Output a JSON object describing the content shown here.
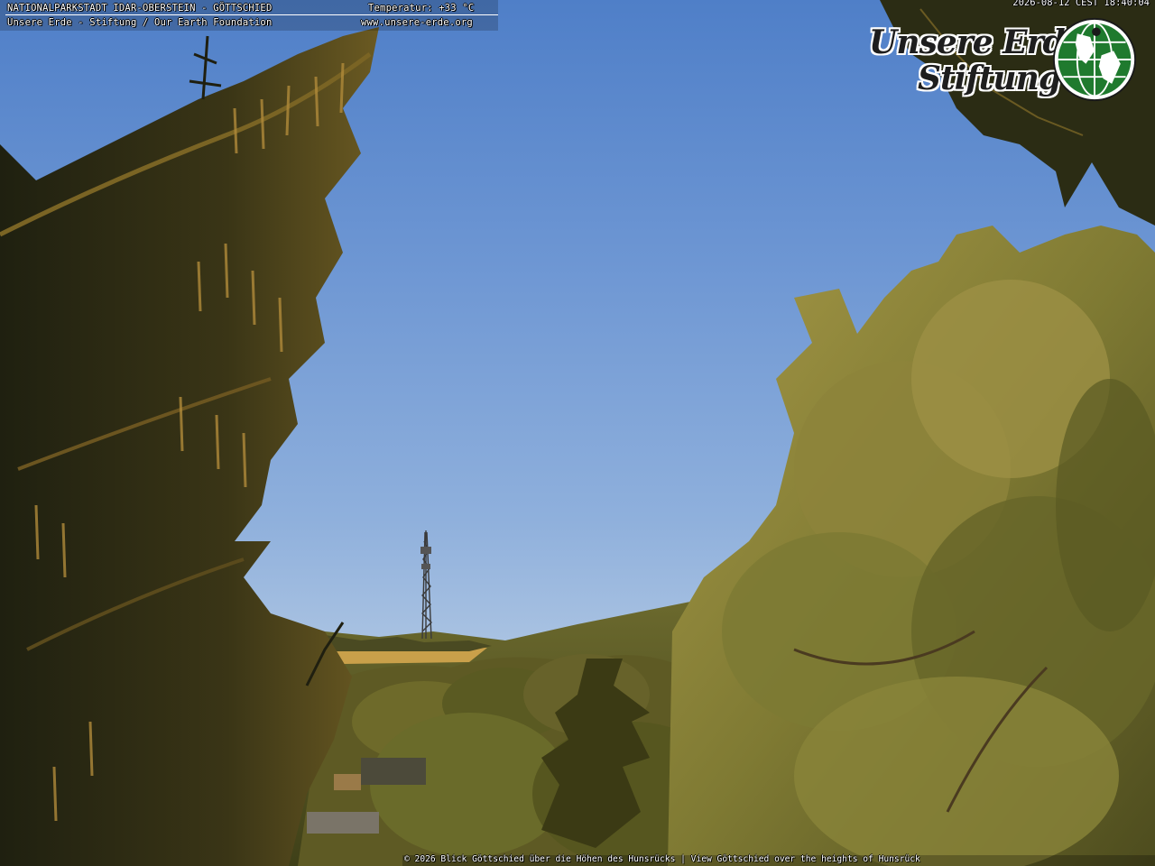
{
  "webcam": {
    "title": "NATIONALPARKSTADT IDAR-OBERSTEIN - GÖTTSCHIED",
    "temperature": "Temperatur: +33 °C",
    "foundation": "Unsere Erde - Stiftung / Our Earth Foundation",
    "url": "www.unsere-erde.org",
    "timestamp": "2026-08-12 CEST 18:40:04",
    "bottom_caption": "© 2026   Blick Göttschied über die Höhen des Hunsrücks  |  View Göttschied over the heights of Hunsrück"
  },
  "logo": {
    "line1": "Unsere Erde",
    "line2": "Stiftung",
    "icon": "globe-icon"
  },
  "colors": {
    "sky_top": "#4f7fc8",
    "sky_bottom": "#bccfe6",
    "spruce_dark": "#2a2b14",
    "foliage_lit": "#8f8a3a",
    "logo_green": "#1f7a2e"
  }
}
